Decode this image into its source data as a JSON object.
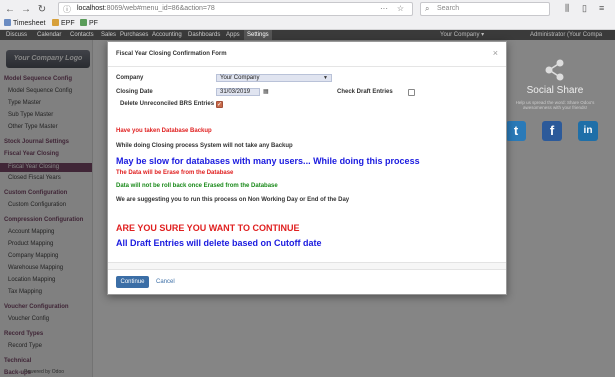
{
  "browser": {
    "url_host": "localhost",
    "url_path": ":8069/web#menu_id=86&action=78",
    "search_placeholder": "Search",
    "bookmarks": [
      "Timesheet",
      "EPF",
      "PF"
    ]
  },
  "topmenu": {
    "items": [
      "Discuss",
      "Calendar",
      "Contacts",
      "Sales",
      "Purchases",
      "Accounting",
      "Dashboards",
      "Apps",
      "Settings"
    ],
    "active": "Settings",
    "right_items": [
      "Your Company ▾",
      "Administrator (Your Compa"
    ]
  },
  "sidebar": {
    "logo_text": "Your Company Logo",
    "entries": [
      {
        "type": "sec",
        "label": "Model Sequence Config"
      },
      {
        "type": "item",
        "label": "Model Sequence Config"
      },
      {
        "type": "item",
        "label": "Type Master"
      },
      {
        "type": "item",
        "label": "Sub Type Master"
      },
      {
        "type": "item",
        "label": "Other Type Master"
      },
      {
        "type": "sec",
        "label": "Stock Journal Settings"
      },
      {
        "type": "sec",
        "label": "Fiscal Year Closing"
      },
      {
        "type": "item",
        "label": "Fiscal Year Closing",
        "active": true
      },
      {
        "type": "item",
        "label": "Closed Fiscal Years"
      },
      {
        "type": "sec",
        "label": "Custom Configuration"
      },
      {
        "type": "item",
        "label": "Custom Configuration"
      },
      {
        "type": "sec",
        "label": "Compression Configuration"
      },
      {
        "type": "item",
        "label": "Account Mapping"
      },
      {
        "type": "item",
        "label": "Product Mapping"
      },
      {
        "type": "item",
        "label": "Company Mapping"
      },
      {
        "type": "item",
        "label": "Warehouse Mapping"
      },
      {
        "type": "item",
        "label": "Location Mapping"
      },
      {
        "type": "item",
        "label": "Tax Mapping"
      },
      {
        "type": "sec",
        "label": "Voucher Configuration"
      },
      {
        "type": "item",
        "label": "Voucher Config"
      },
      {
        "type": "sec",
        "label": "Record Types"
      },
      {
        "type": "item",
        "label": "Record Type"
      },
      {
        "type": "sec",
        "label": "Technical"
      },
      {
        "type": "sec",
        "label": "Back-ups"
      }
    ],
    "powered": "Powered by Odoo"
  },
  "share": {
    "title": "Social Share",
    "text": "Help us spread the word: Share Odoo's awesomeness with your friends!"
  },
  "modal": {
    "title": "Fiscal Year Closing Confirmation Form",
    "company_label": "Company",
    "company_value": "Your Company",
    "closing_date_label": "Closing Date",
    "closing_date_value": "31/03/2019",
    "check_draft_label": "Check Draft Entries",
    "check_draft_checked": false,
    "delete_unreconciled_label": "Delete Unreconciled BRS Entries",
    "delete_unreconciled_checked": true,
    "messages": [
      {
        "text": "Have you taken Database Backup",
        "color": "#e02020",
        "size": "small"
      },
      {
        "text": "While doing Closing process System will not take any Backup",
        "color": "#333333",
        "size": "small"
      },
      {
        "text": "May be slow for databases with many users... While doing this process",
        "color": "#1a1adf",
        "size": "big"
      },
      {
        "text": "The Data will be Erase from the Database",
        "color": "#e02020",
        "size": "small"
      },
      {
        "text": "Data will not be roll back once Erased from the Database",
        "color": "#1a8a1a",
        "size": "small"
      },
      {
        "text": "We are suggesting you to run this process on Non Working Day or End of the Day",
        "color": "#333333",
        "size": "small"
      },
      {
        "text": "ARE YOU SURE YOU WANT TO CONTINUE",
        "color": "#e02020",
        "size": "big"
      },
      {
        "text": "All Draft Entries will delete based on Cutoff date",
        "color": "#1a1adf",
        "size": "big"
      }
    ],
    "continue_label": "Continue",
    "cancel_label": "Cancel"
  }
}
